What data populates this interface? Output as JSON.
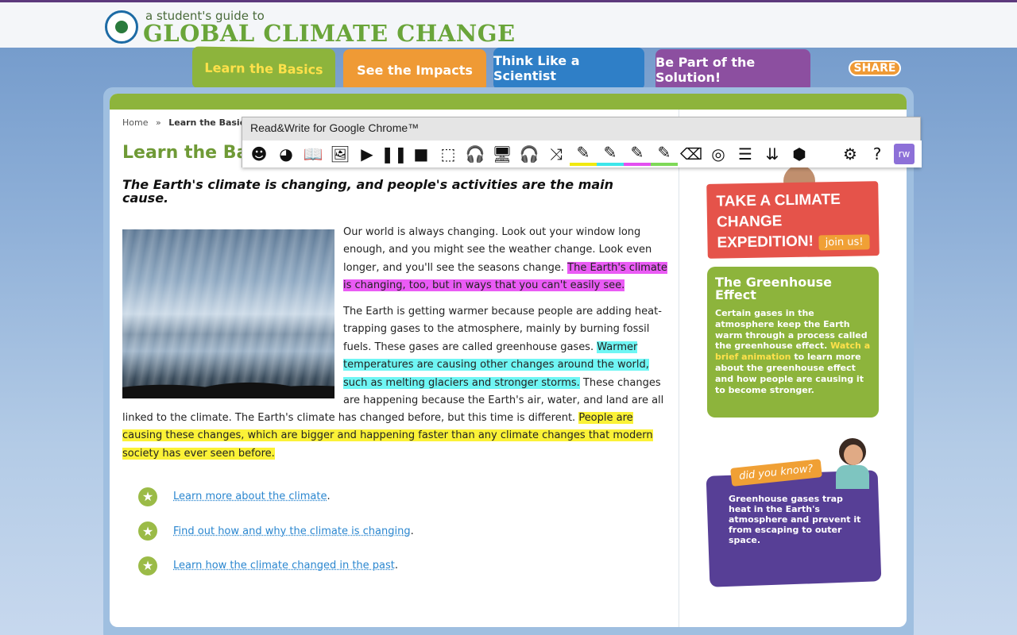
{
  "header": {
    "tagline": "a student's guide to",
    "title": "GLOBAL CLIMATE CHANGE"
  },
  "nav": {
    "tabs": [
      {
        "label": "Learn the Basics",
        "color": "#8db43c"
      },
      {
        "label": "See the Impacts",
        "color": "#ef9a35"
      },
      {
        "label": "Think Like  a Scientist",
        "color": "#2f7fc7"
      },
      {
        "label": "Be Part of the Solution!",
        "color": "#8c4fa0"
      }
    ],
    "share_label": "SHARE"
  },
  "readwrite": {
    "title": "Read&Write for Google Chrome™",
    "tools": [
      "text-to-speech-icon",
      "speech-input-icon",
      "dictionary-icon",
      "picture-dictionary-icon",
      "play-icon",
      "pause-icon",
      "stop-icon",
      "screenshot-reader-icon",
      "audio-maker-icon",
      "screen-mask-icon",
      "talk-and-type-icon",
      "translator-icon",
      "highlight-yellow-icon",
      "highlight-cyan-icon",
      "highlight-pink-icon",
      "highlight-green-icon",
      "clear-highlights-icon",
      "collect-highlights-icon",
      "vocabulary-icon",
      "simplify-page-icon",
      "check-it-icon",
      "settings-icon",
      "help-icon",
      "rw-logo-icon"
    ],
    "glyphs": [
      "☻",
      "◕",
      "📖",
      "🖼",
      "▶",
      "❚❚",
      "■",
      "⬚",
      "🎧",
      "🖥",
      "🎧",
      "⤨",
      "✎",
      "✎",
      "✎",
      "✎",
      "⌫",
      "◎",
      "☰",
      "⇊",
      "⬢",
      "⚙",
      "?",
      "rw"
    ]
  },
  "breadcrumb": {
    "home": "Home",
    "sep": "»",
    "current": "Learn the Basics"
  },
  "main": {
    "title": "Learn the Basics",
    "lead": "The Earth's climate is changing, and people's activities are the main cause.",
    "p1_plain": "Our world is always changing. Look out your window long enough, and you might see the weather change. Look even longer, and you'll see the seasons change. ",
    "p1_highlight": "The Earth's climate is changing, too, but in ways that you can't easily see.",
    "p2_plain_a": "The Earth is getting warmer because people are adding heat-trapping gases to the atmosphere, mainly by burning fossil fuels. These gases are called greenhouse gases. ",
    "p2_highlight_cyan": "Warmer temperatures are causing other changes around the world, such as melting glaciers and stronger storms.",
    "p2_plain_b": " These changes are happening because the Earth's air, water, and land are all",
    "p2_plain_c": "linked to the climate. The Earth's climate has changed before, but this time is different. ",
    "p2_highlight_yellow": "People are causing these changes, which are bigger and happening faster than any climate changes that modern society has ever seen before.",
    "links": [
      {
        "label": "Learn more about the climate",
        "suffix": "."
      },
      {
        "label": "Find out how and why the climate is changing",
        "suffix": "."
      },
      {
        "label": "Learn how the climate changed in the past",
        "suffix": "."
      }
    ]
  },
  "sidebar": {
    "expedition_title": "TAKE A CLIMATE CHANGE EXPEDITION!",
    "join_label": "join us!",
    "greenhouse_title": "The Greenhouse Effect",
    "greenhouse_text_a": "Certain gases in the atmosphere keep the Earth warm through a process called the greenhouse effect. ",
    "greenhouse_link": "Watch a brief animation",
    "greenhouse_text_b": " to learn more about the greenhouse effect and how people are causing it to become stronger.",
    "dyk_badge": "did you know?",
    "dyk_text": "Greenhouse gases trap heat in the Earth's atmosphere and prevent it from escaping to outer space."
  },
  "colors": {
    "brand_green": "#8db43c",
    "highlight_pink": "#ea5bf5",
    "highlight_cyan": "#6ff6f4",
    "highlight_yellow": "#fbf237"
  }
}
